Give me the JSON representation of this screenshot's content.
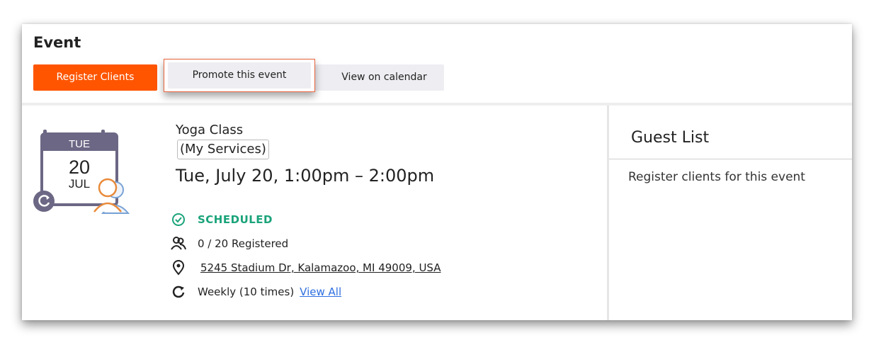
{
  "header": {
    "title": "Event",
    "buttons": {
      "register": "Register Clients",
      "promote": "Promote this event",
      "calendar": "View on calendar"
    }
  },
  "calendar_icon": {
    "weekday": "TUE",
    "day": "20",
    "month": "JUL"
  },
  "event": {
    "name": "Yoga Class",
    "category": "(My Services)",
    "datetime": "Tue, July 20, 1:00pm – 2:00pm",
    "status": "SCHEDULED",
    "registered": "0 / 20 Registered",
    "address": "5245 Stadium Dr, Kalamazoo, MI 49009, USA",
    "recurrence": "Weekly (10 times)",
    "view_all": "View All"
  },
  "guest_list": {
    "title": "Guest List",
    "empty_text": "Register clients for this event"
  },
  "colors": {
    "accent": "#ff5500",
    "status": "#1aa37a",
    "link": "#2f6fe0",
    "calendar": "#6b6784"
  }
}
